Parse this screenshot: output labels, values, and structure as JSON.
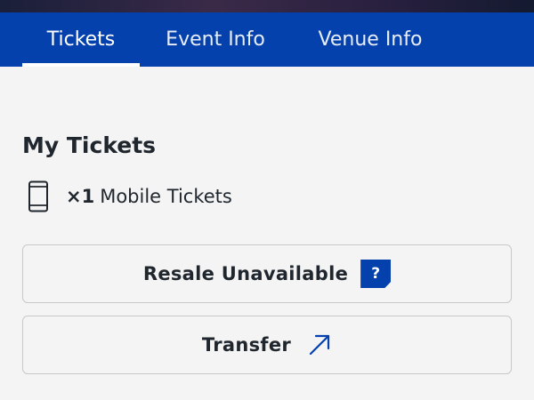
{
  "tabs": [
    {
      "label": "Tickets",
      "active": true
    },
    {
      "label": "Event Info",
      "active": false
    },
    {
      "label": "Venue Info",
      "active": false
    }
  ],
  "my_tickets": {
    "title": "My Tickets",
    "count_label": "×1",
    "type_label": "Mobile Tickets",
    "icon": "mobile-phone-icon"
  },
  "resale_button": {
    "label": "Resale Unavailable",
    "help_badge": "?"
  },
  "transfer_button": {
    "label": "Transfer",
    "icon": "arrow-up-right-icon"
  },
  "colors": {
    "brand_blue": "#0441ad",
    "background": "#f4f4f4",
    "text": "#1f262d",
    "border": "#c8c8c8"
  }
}
